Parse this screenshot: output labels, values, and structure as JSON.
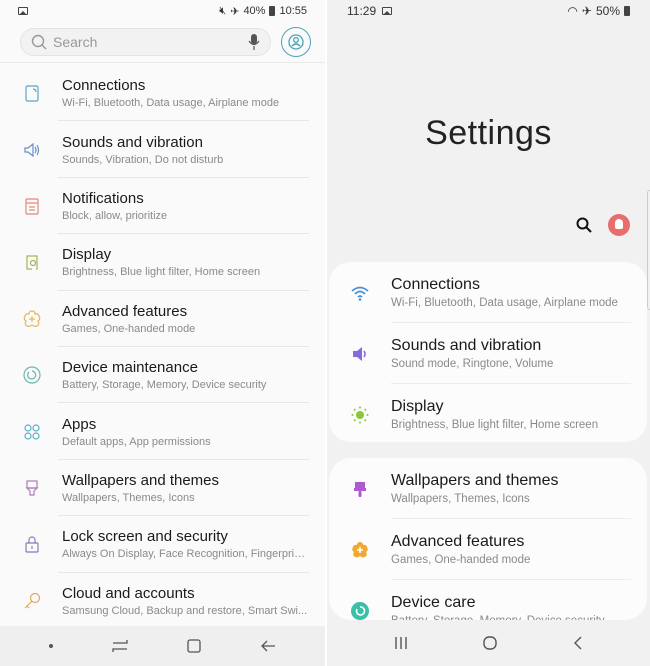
{
  "left": {
    "status_bar": {
      "battery": "40%",
      "time": "10:55"
    },
    "search": {
      "placeholder": "Search"
    },
    "items": [
      {
        "title": "Connections",
        "subtitle": "Wi-Fi, Bluetooth, Data usage, Airplane mode",
        "icon": "connections-icon",
        "color": "#5aa6c0"
      },
      {
        "title": "Sounds and vibration",
        "subtitle": "Sounds, Vibration, Do not disturb",
        "icon": "speaker-icon",
        "color": "#6a8ec9"
      },
      {
        "title": "Notifications",
        "subtitle": "Block, allow, prioritize",
        "icon": "notifications-icon",
        "color": "#e08878"
      },
      {
        "title": "Display",
        "subtitle": "Brightness, Blue light filter, Home screen",
        "icon": "display-icon",
        "color": "#a3b45a"
      },
      {
        "title": "Advanced features",
        "subtitle": "Games, One-handed mode",
        "icon": "advanced-features-icon",
        "color": "#e0b860"
      },
      {
        "title": "Device maintenance",
        "subtitle": "Battery, Storage, Memory, Device security",
        "icon": "device-maintenance-icon",
        "color": "#6ab8b0"
      },
      {
        "title": "Apps",
        "subtitle": "Default apps, App permissions",
        "icon": "apps-icon",
        "color": "#5ab0c0"
      },
      {
        "title": "Wallpapers and themes",
        "subtitle": "Wallpapers, Themes, Icons",
        "icon": "brush-icon",
        "color": "#b07ab8"
      },
      {
        "title": "Lock screen and security",
        "subtitle": "Always On Display, Face Recognition, Fingerprin...",
        "icon": "lock-icon",
        "color": "#8a7ab8"
      },
      {
        "title": "Cloud and accounts",
        "subtitle": "Samsung Cloud, Backup and restore, Smart Swi...",
        "icon": "key-icon",
        "color": "#e0a860"
      }
    ]
  },
  "right": {
    "status_bar": {
      "time": "11:29",
      "battery": "50%"
    },
    "title": "Settings",
    "card1": [
      {
        "title": "Connections",
        "subtitle": "Wi-Fi, Bluetooth, Data usage, Airplane mode",
        "icon": "wifi-icon",
        "color": "#4a90d9"
      },
      {
        "title": "Sounds and vibration",
        "subtitle": "Sound mode, Ringtone, Volume",
        "icon": "speaker-icon",
        "color": "#8a6ad9"
      },
      {
        "title": "Display",
        "subtitle": "Brightness, Blue light filter, Home screen",
        "icon": "sun-icon",
        "color": "#8ac83a"
      }
    ],
    "card2": [
      {
        "title": "Wallpapers and themes",
        "subtitle": "Wallpapers, Themes, Icons",
        "icon": "brush-icon",
        "color": "#b05ad0"
      },
      {
        "title": "Advanced features",
        "subtitle": "Games, One-handed mode",
        "icon": "advanced-features-icon",
        "color": "#f0a830"
      },
      {
        "title": "Device care",
        "subtitle": "Battery, Storage, Memory, Device security",
        "icon": "device-care-icon",
        "color": "#3ac0a8"
      }
    ]
  }
}
